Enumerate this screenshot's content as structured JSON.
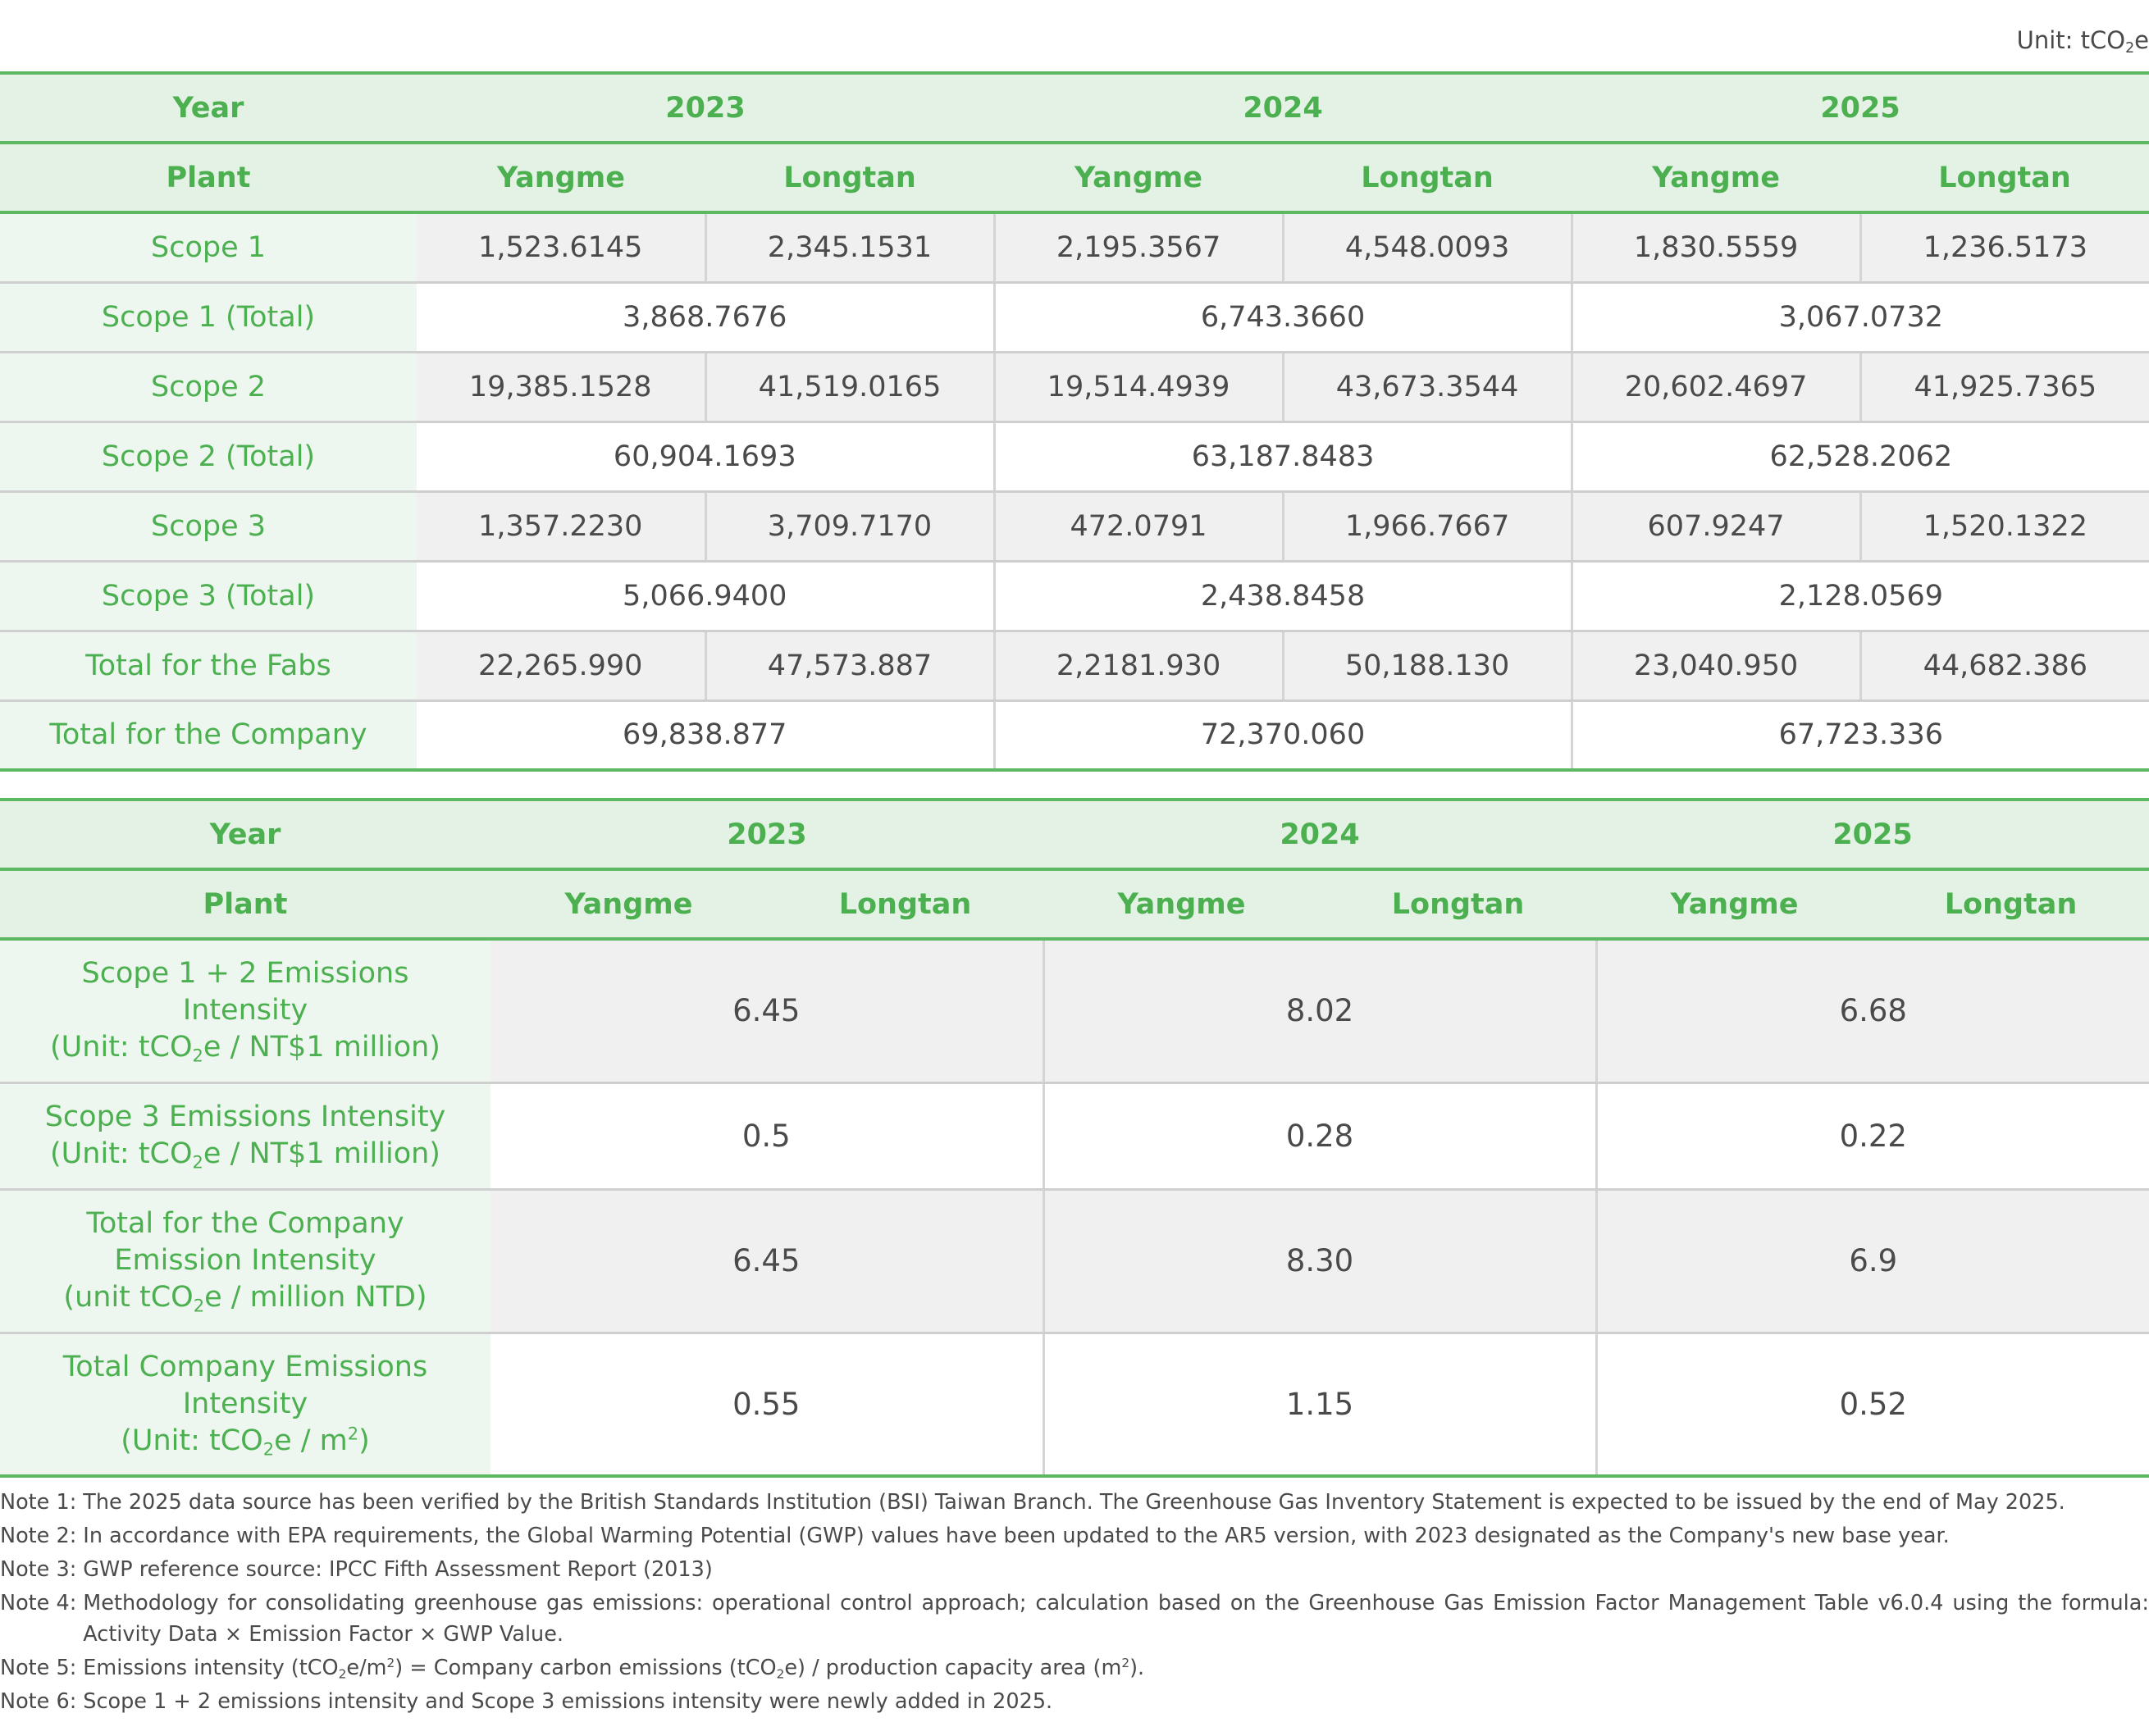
{
  "unit_label": "Unit: tCO",
  "unit_sub": "2",
  "unit_suffix": "e",
  "table1": {
    "year_label": "Year",
    "plant_label": "Plant",
    "years": [
      "2023",
      "2024",
      "2025"
    ],
    "plants": [
      "Yangme",
      "Longtan",
      "Yangme",
      "Longtan",
      "Yangme",
      "Longtan"
    ],
    "rows": [
      {
        "label": "Scope 1",
        "type": "split",
        "values": [
          "1,523.6145",
          "2,345.1531",
          "2,195.3567",
          "4,548.0093",
          "1,830.5559",
          "1,236.5173"
        ]
      },
      {
        "label": "Scope 1 (Total)",
        "type": "merged",
        "values": [
          "3,868.7676",
          "6,743.3660",
          "3,067.0732"
        ]
      },
      {
        "label": "Scope 2",
        "type": "split",
        "values": [
          "19,385.1528",
          "41,519.0165",
          "19,514.4939",
          "43,673.3544",
          "20,602.4697",
          "41,925.7365"
        ]
      },
      {
        "label": "Scope 2 (Total)",
        "type": "merged",
        "values": [
          "60,904.1693",
          "63,187.8483",
          "62,528.2062"
        ]
      },
      {
        "label": "Scope 3",
        "type": "split",
        "values": [
          "1,357.2230",
          "3,709.7170",
          "472.0791",
          "1,966.7667",
          "607.9247",
          "1,520.1322"
        ]
      },
      {
        "label": "Scope 3 (Total)",
        "type": "merged",
        "values": [
          "5,066.9400",
          "2,438.8458",
          "2,128.0569"
        ]
      },
      {
        "label": "Total for the Fabs",
        "type": "split",
        "values": [
          "22,265.990",
          "47,573.887",
          "2,2181.930",
          "50,188.130",
          "23,040.950",
          "44,682.386"
        ]
      },
      {
        "label": "Total for the Company",
        "type": "merged",
        "values": [
          "69,838.877",
          "72,370.060",
          "67,723.336"
        ]
      }
    ]
  },
  "table2": {
    "year_label": "Year",
    "plant_label": "Plant",
    "years": [
      "2023",
      "2024",
      "2025"
    ],
    "plants": [
      "Yangme",
      "Longtan",
      "Yangme",
      "Longtan",
      "Yangme",
      "Longtan"
    ],
    "rows": [
      {
        "label_lines": [
          "Scope 1 + 2 Emissions",
          "Intensity"
        ],
        "unit_line": {
          "pre": "(Unit: tCO",
          "sub": "2",
          "post": "e / NT$1 million)"
        },
        "values": [
          "6.45",
          "8.02",
          "6.68"
        ]
      },
      {
        "label_lines": [
          "Scope 3 Emissions Intensity"
        ],
        "unit_line": {
          "pre": "(Unit: tCO",
          "sub": "2",
          "post": "e / NT$1 million)"
        },
        "values": [
          "0.5",
          "0.28",
          "0.22"
        ]
      },
      {
        "label_lines": [
          "Total for the Company",
          "Emission Intensity"
        ],
        "unit_line": {
          "pre": "(unit tCO",
          "sub": "2",
          "post": "e / million NTD)"
        },
        "values": [
          "6.45",
          "8.30",
          "6.9"
        ]
      },
      {
        "label_lines": [
          "Total Company Emissions",
          "Intensity"
        ],
        "unit_line": {
          "pre": "(Unit: tCO",
          "sub": "2",
          "post": "e / m",
          "sup": "2",
          "end": ")"
        },
        "values": [
          "0.55",
          "1.15",
          "0.52"
        ]
      }
    ]
  },
  "notes": [
    {
      "label": "Note 1:",
      "text": "The 2025 data source has been verified by the British Standards Institution (BSI) Taiwan Branch. The Greenhouse Gas Inventory Statement is expected to be issued by the end of May 2025."
    },
    {
      "label": "Note 2:",
      "text": "In accordance with EPA requirements, the Global Warming Potential (GWP) values have been updated to the AR5 version, with 2023 designated as the Company's new base year."
    },
    {
      "label": "Note 3:",
      "text": "GWP reference source: IPCC Fifth Assessment Report (2013)"
    },
    {
      "label": "Note 4:",
      "text": "Methodology for consolidating greenhouse gas emissions: operational control approach; calculation based on the Greenhouse Gas Emission Factor Management Table v6.0.4 using the formula: Activity Data × Emission Factor × GWP Value."
    },
    {
      "label": "Note 5:",
      "parts": {
        "a": "Emissions intensity (tCO",
        "a_sub": "2",
        "b": "e/m",
        "b_sup": "2",
        "c": ") = Company carbon emissions (tCO",
        "c_sub": "2",
        "d": "e) / production capacity area (m",
        "d_sup": "2",
        "e": ")."
      }
    },
    {
      "label": "Note 6:",
      "text": "Scope 1 + 2 emissions intensity and Scope 3 emissions intensity were newly added in 2025."
    }
  ]
}
